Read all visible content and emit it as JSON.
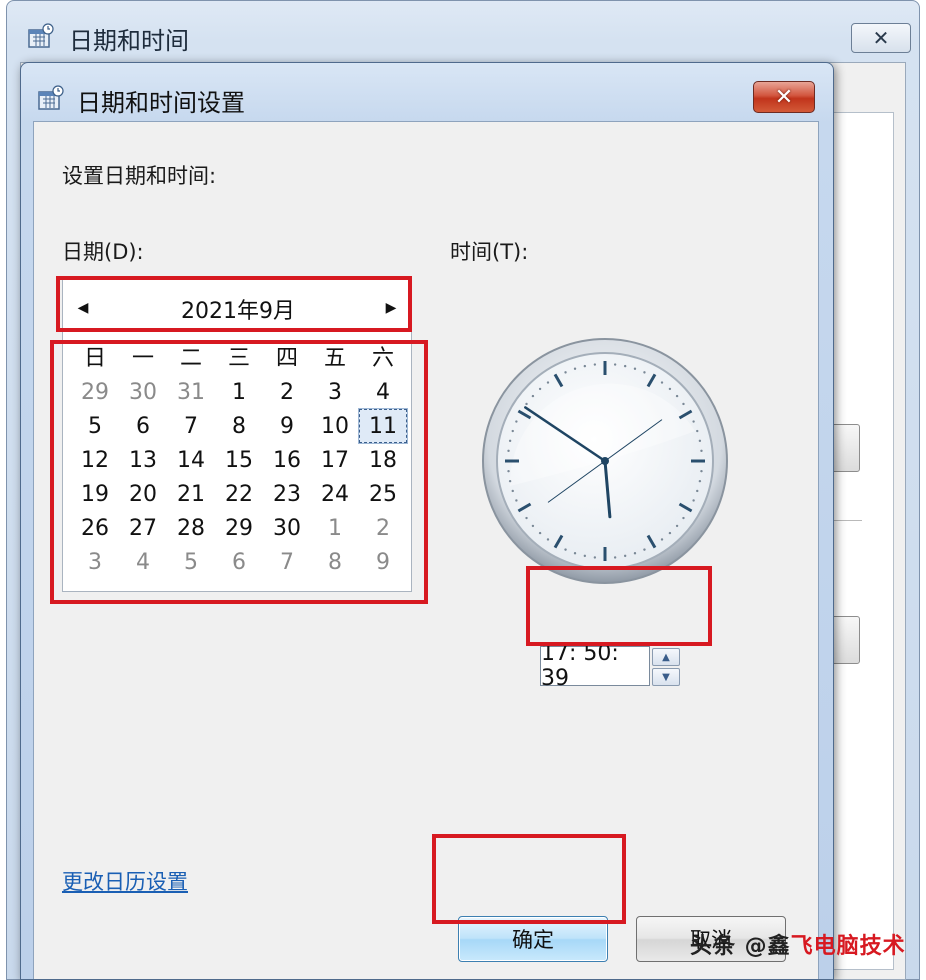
{
  "background_window": {
    "title": "日期和时间",
    "close_glyph": "✕"
  },
  "dialog": {
    "title": "日期和时间设置",
    "close_glyph": "✕",
    "setup_label": "设置日期和时间:",
    "date_label": "日期(D):",
    "time_label": "时间(T):",
    "calendar": {
      "month_label": "2021年9月",
      "prev_glyph": "◀",
      "next_glyph": "▶",
      "weekdays": [
        "日",
        "一",
        "二",
        "三",
        "四",
        "五",
        "六"
      ],
      "weeks": [
        [
          "29",
          "30",
          "31",
          "1",
          "2",
          "3",
          "4"
        ],
        [
          "5",
          "6",
          "7",
          "8",
          "9",
          "10",
          "11"
        ],
        [
          "12",
          "13",
          "14",
          "15",
          "16",
          "17",
          "18"
        ],
        [
          "19",
          "20",
          "21",
          "22",
          "23",
          "24",
          "25"
        ],
        [
          "26",
          "27",
          "28",
          "29",
          "30",
          "1",
          "2"
        ],
        [
          "3",
          "4",
          "5",
          "6",
          "7",
          "8",
          "9"
        ]
      ],
      "selected_day": "11"
    },
    "clock": {
      "hour": 17,
      "minute": 50,
      "second": 39
    },
    "time_value": "17: 50: 39",
    "spin_up_glyph": "▲",
    "spin_down_glyph": "▼",
    "calendar_settings_link": "更改日历设置",
    "ok_label": "确定",
    "cancel_label": "取消"
  },
  "watermark": {
    "prefix": "头条 @鑫",
    "red": "飞电脑技术"
  },
  "colors": {
    "highlight": "#d71921",
    "link": "#1a5fb4",
    "today_border": "#3b5f8c"
  }
}
